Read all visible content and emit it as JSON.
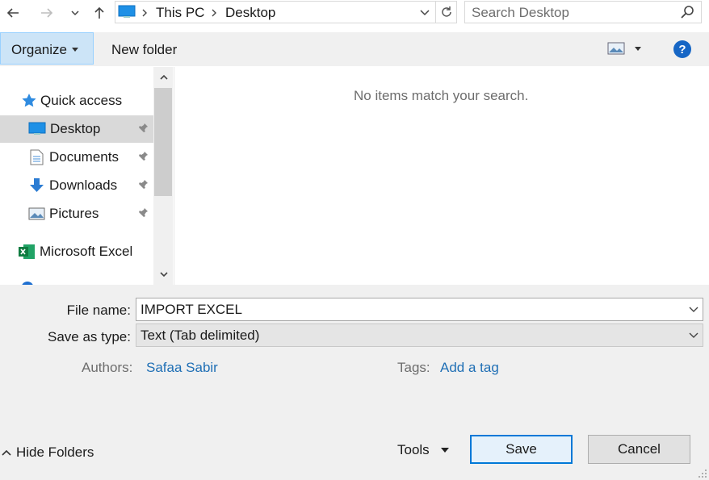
{
  "address_bar": {
    "segments": [
      "This PC",
      "Desktop"
    ],
    "search_placeholder": "Search Desktop"
  },
  "toolbar": {
    "organize_label": "Organize",
    "new_folder_label": "New folder"
  },
  "content": {
    "empty_message": "No items match your search."
  },
  "nav": {
    "quick_access": "Quick access",
    "items": [
      {
        "label": "Desktop",
        "icon": "desktop-icon",
        "pinned": true,
        "selected": true
      },
      {
        "label": "Documents",
        "icon": "documents-icon",
        "pinned": true
      },
      {
        "label": "Downloads",
        "icon": "downloads-icon",
        "pinned": true
      },
      {
        "label": "Pictures",
        "icon": "pictures-icon",
        "pinned": true
      }
    ],
    "excel_label": "Microsoft Excel"
  },
  "form": {
    "file_name_label": "File name:",
    "file_name_value": "IMPORT EXCEL",
    "save_type_label": "Save as type:",
    "save_type_value": "Text (Tab delimited)",
    "authors_label": "Authors:",
    "authors_value": "Safaa Sabir",
    "tags_label": "Tags:",
    "tags_value": "Add a tag"
  },
  "footer": {
    "hide_folders_label": "Hide Folders",
    "tools_label": "Tools",
    "save_label": "Save",
    "cancel_label": "Cancel"
  },
  "colors": {
    "accent": "#0078d7",
    "selection": "#cce4f7",
    "link": "#1f6fb5"
  }
}
